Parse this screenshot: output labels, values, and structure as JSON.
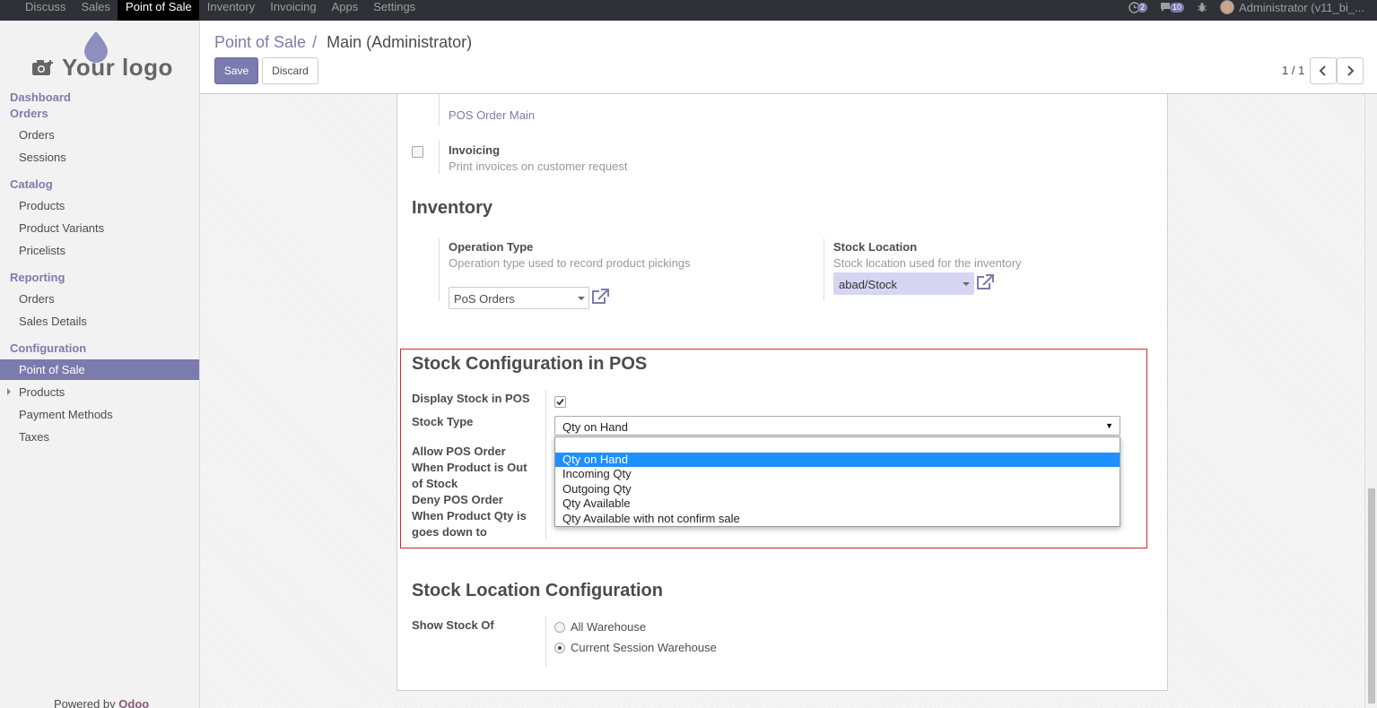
{
  "topbar": {
    "menu": [
      "Discuss",
      "Sales",
      "Point of Sale",
      "Inventory",
      "Invoicing",
      "Apps",
      "Settings"
    ],
    "active_menu": "Point of Sale",
    "activity_count": "2",
    "messages_count": "10",
    "user": "Administrator (v11_bi_..."
  },
  "sidebar": {
    "logo_text": "Your logo",
    "dashboard": "Dashboard",
    "orders_head": "Orders",
    "orders": "Orders",
    "sessions": "Sessions",
    "catalog_head": "Catalog",
    "products": "Products",
    "product_variants": "Product Variants",
    "pricelists": "Pricelists",
    "reporting_head": "Reporting",
    "reporting_orders": "Orders",
    "sales_details": "Sales Details",
    "configuration_head": "Configuration",
    "point_of_sale": "Point of Sale",
    "config_products": "Products",
    "payment_methods": "Payment Methods",
    "taxes": "Taxes",
    "powered_by": "Powered by",
    "odoo": "Odoo"
  },
  "control_panel": {
    "breadcrumb_parent": "Point of Sale",
    "breadcrumb_sep": "/",
    "breadcrumb_current": "Main (Administrator)",
    "save": "Save",
    "discard": "Discard",
    "pager": "1 / 1"
  },
  "form": {
    "pos_order_main": "POS Order Main",
    "invoicing_label": "Invoicing",
    "invoicing_help": "Print invoices on customer request",
    "inventory_title": "Inventory",
    "operation_type_label": "Operation Type",
    "operation_type_help": "Operation type used to record product pickings",
    "operation_type_value": "PoS Orders",
    "stock_location_label": "Stock Location",
    "stock_location_help": "Stock location used for the inventory",
    "stock_location_value": "abad/Stock",
    "stock_config_title": "Stock Configuration in POS",
    "display_stock_label": "Display Stock in POS",
    "display_stock_checked": true,
    "stock_type_label": "Stock Type",
    "stock_type_value": "Qty on Hand",
    "stock_type_options": [
      "Qty on Hand",
      "Incoming Qty",
      "Outgoing Qty",
      "Qty Available",
      "Qty Available with not confirm sale"
    ],
    "allow_pos_label": [
      "Allow POS Order",
      "When Product is Out",
      "of Stock"
    ],
    "deny_pos_label": [
      "Deny POS Order",
      "When Product Qty is",
      "goes down to"
    ],
    "stock_location_config_title": "Stock Location Configuration",
    "show_stock_of_label": "Show Stock Of",
    "show_stock_options": [
      "All Warehouse",
      "Current Session Warehouse"
    ],
    "show_stock_selected": "Current Session Warehouse"
  },
  "colors": {
    "accent": "#7c7bad",
    "topbar": "#2f3136",
    "highlight_border": "#d9262b",
    "dropdown_selected": "#1e90ff"
  }
}
